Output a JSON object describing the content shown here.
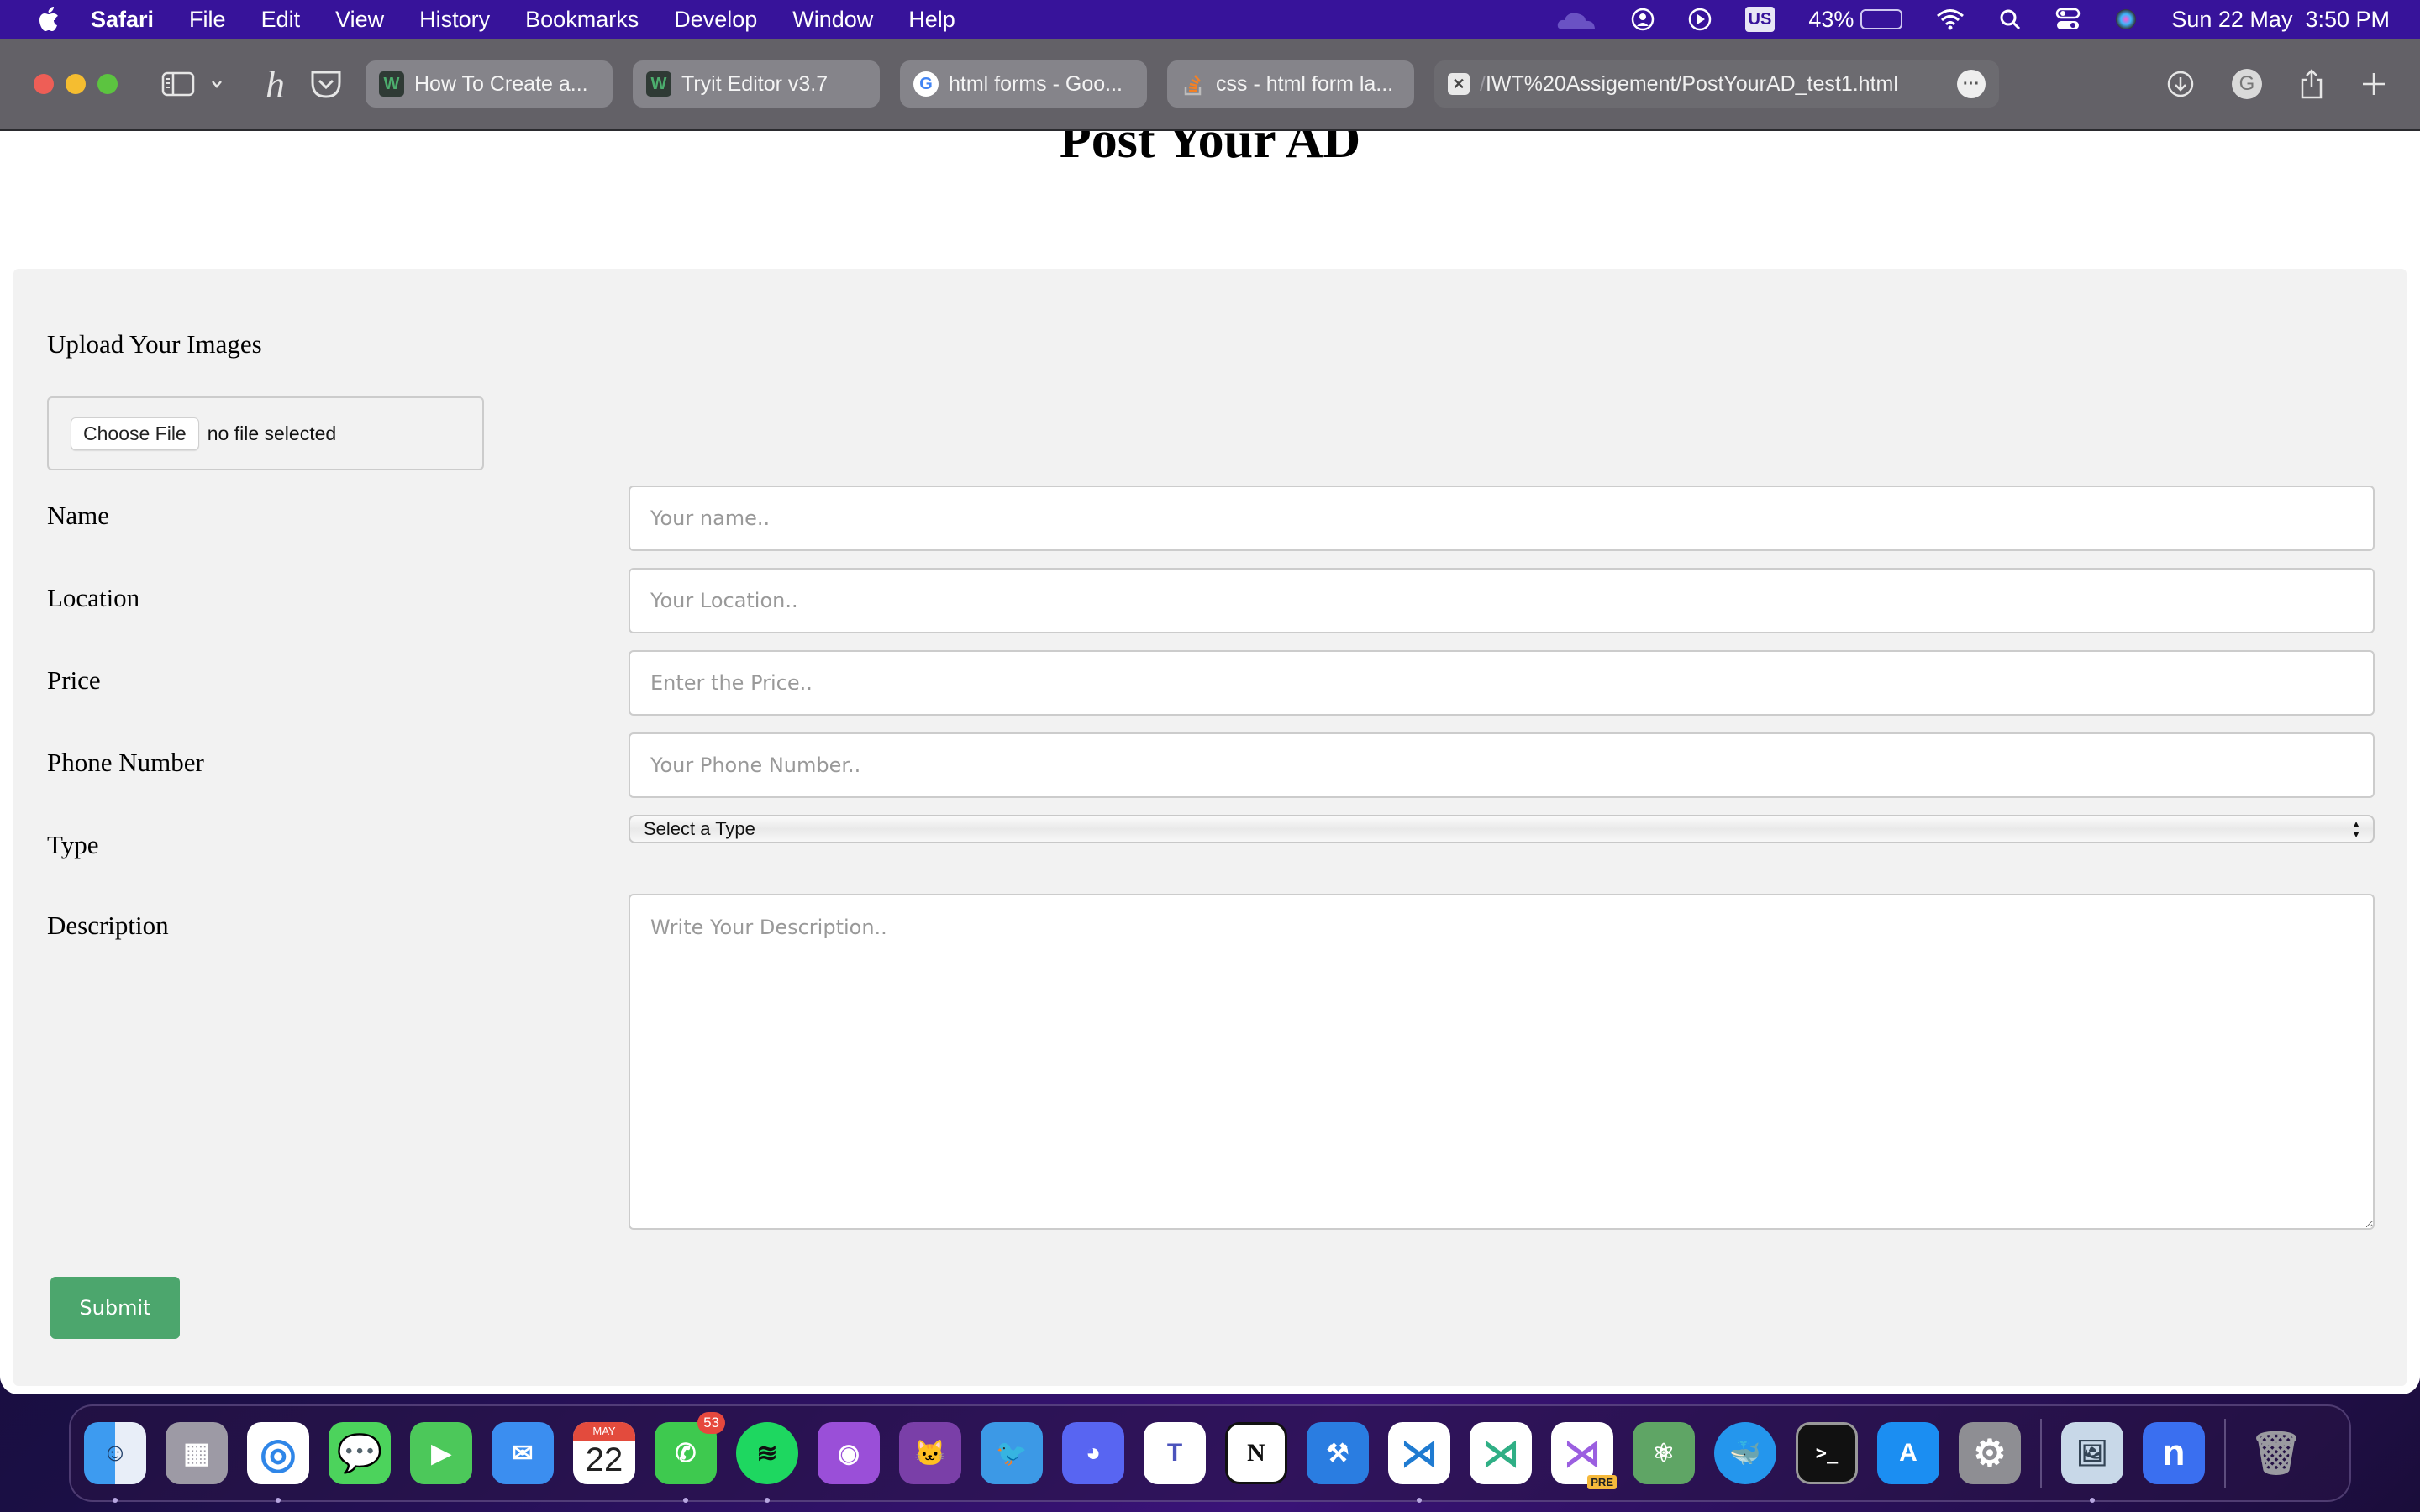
{
  "menubar": {
    "app_name": "Safari",
    "items": [
      "File",
      "Edit",
      "View",
      "History",
      "Bookmarks",
      "Develop",
      "Window",
      "Help"
    ],
    "keyboard_layout": "US",
    "battery_percent": "43%",
    "battery_level": 0.43,
    "datetime": "Sun 22 May  3:50 PM"
  },
  "browser": {
    "tabs": [
      {
        "title": "How To Create a...",
        "favicon": "w3schools-icon"
      },
      {
        "title": "Tryit Editor v3.7",
        "favicon": "w3schools-icon"
      },
      {
        "title": "html forms - Goo...",
        "favicon": "google-icon"
      },
      {
        "title": "css - html form la...",
        "favicon": "stackoverflow-icon"
      }
    ],
    "active_tab": {
      "url_prefix": "/",
      "url": "IWT%20Assigement/PostYourAD_test1.html"
    }
  },
  "page": {
    "title": "Post Your AD",
    "upload": {
      "label": "Upload Your Images",
      "button": "Choose File",
      "status": "no file selected"
    },
    "fields": [
      {
        "label": "Name",
        "placeholder": "Your name.."
      },
      {
        "label": "Location",
        "placeholder": "Your Location.."
      },
      {
        "label": "Price",
        "placeholder": "Enter the Price.."
      },
      {
        "label": "Phone Number",
        "placeholder": "Your Phone Number.."
      }
    ],
    "type": {
      "label": "Type",
      "selected": "Select a Type"
    },
    "description": {
      "label": "Description",
      "placeholder": "Write Your Description.."
    },
    "submit_label": "Submit",
    "accent_color": "#4ca66d"
  },
  "dock": {
    "apps": [
      {
        "name": "Finder",
        "color": "#3d9bf0"
      },
      {
        "name": "Launchpad",
        "color": "#9d9aa5"
      },
      {
        "name": "Safari",
        "color": "#2f86e8"
      },
      {
        "name": "Messages",
        "color": "#4cd35c"
      },
      {
        "name": "FaceTime",
        "color": "#4cc85a"
      },
      {
        "name": "Mail",
        "color": "#3b8ef0"
      },
      {
        "name": "Calendar",
        "color": "#ffffff",
        "month": "MAY",
        "day": "22"
      },
      {
        "name": "WhatsApp",
        "color": "#3ec94f",
        "badge": "53"
      },
      {
        "name": "Spotify",
        "color": "#1ed760"
      },
      {
        "name": "Podcasts",
        "color": "#9a4fd8"
      },
      {
        "name": "GitHub Desktop",
        "color": "#7a3fa8"
      },
      {
        "name": "Twitter",
        "color": "#3c99e6"
      },
      {
        "name": "Discord",
        "color": "#5865f2"
      },
      {
        "name": "Microsoft Teams",
        "color": "#ffffff"
      },
      {
        "name": "Notion",
        "color": "#ffffff"
      },
      {
        "name": "Xcode",
        "color": "#2a7de1"
      },
      {
        "name": "Visual Studio Code",
        "color": "#ffffff"
      },
      {
        "name": "VSCodium",
        "color": "#ffffff"
      },
      {
        "name": "Visual Studio Preview",
        "color": "#ffffff",
        "tag": "PRE"
      },
      {
        "name": "Atom",
        "color": "#5fa565"
      },
      {
        "name": "Docker",
        "color": "#2496ed"
      },
      {
        "name": "Terminal",
        "color": "#111111"
      },
      {
        "name": "App Store",
        "color": "#1b8ef2"
      },
      {
        "name": "System Preferences",
        "color": "#8e8e93"
      },
      {
        "name": "Preview",
        "color": "#c8d8e8"
      },
      {
        "name": "Nextcloud",
        "color": "#3a6ff0"
      },
      {
        "name": "Trash",
        "color": "#8a8a8e"
      }
    ]
  }
}
